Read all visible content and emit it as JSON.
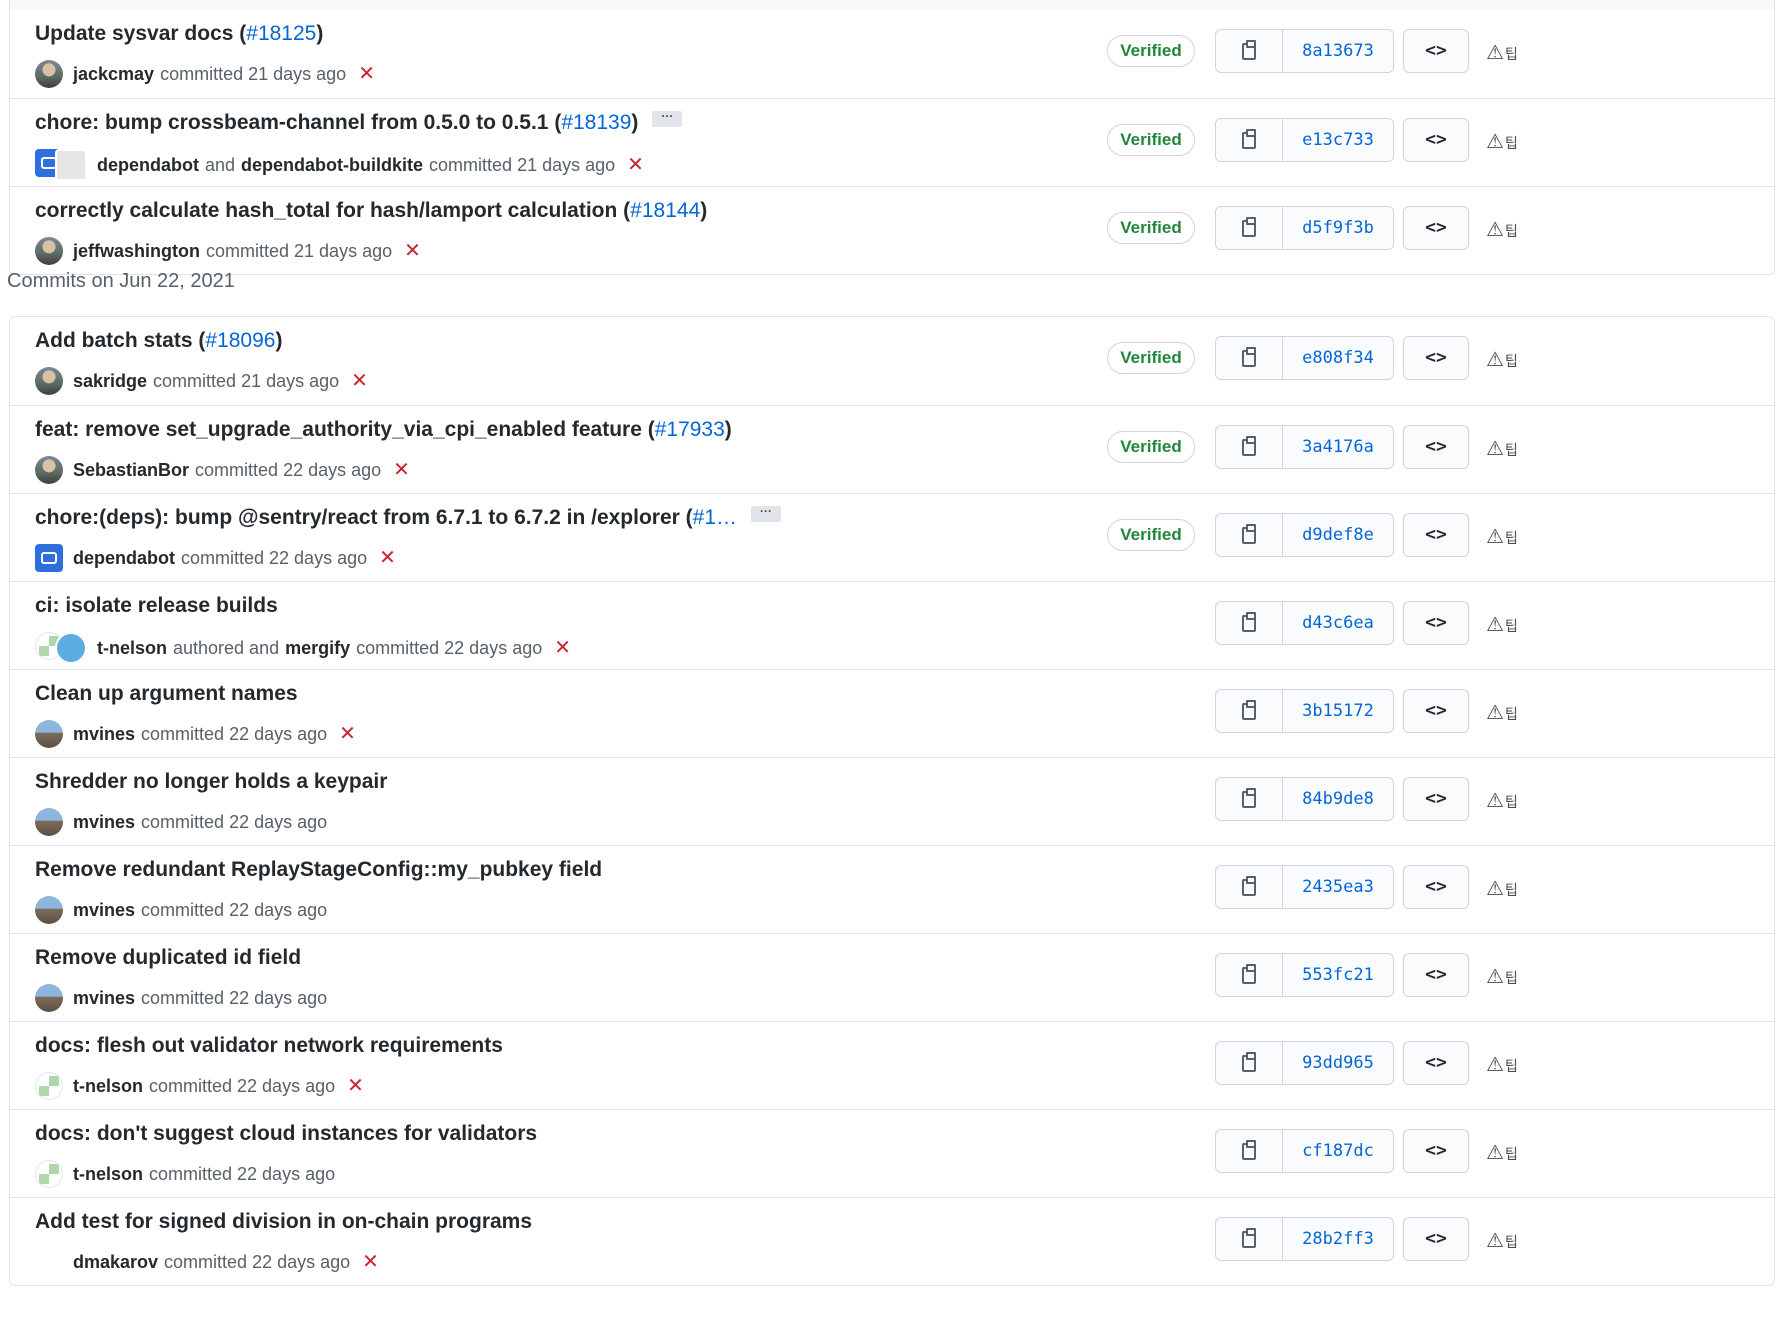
{
  "groups": [
    {
      "heading": "",
      "commits": [
        {
          "title_before": "Update sysvar docs (",
          "pr": "#18125",
          "title_after": ")",
          "has_more": false,
          "avatar": "photo",
          "users": [
            {
              "name": "jackcmay"
            }
          ],
          "meta_text": "committed 21 days ago",
          "status": "failure",
          "verified": "Verified",
          "sha": "8a13673"
        },
        {
          "title_before": "chore: bump crossbeam-channel from 0.5.0 to 0.5.1 (",
          "pr": "#18139",
          "title_after": ")",
          "has_more": true,
          "avatar": "bot-dual",
          "users": [
            {
              "name": "dependabot"
            },
            {
              "name": "dependabot-buildkite"
            }
          ],
          "joiner": "and",
          "meta_text": "committed 21 days ago",
          "status": "failure",
          "verified": "Verified",
          "sha": "e13c733"
        },
        {
          "title_before": "correctly calculate hash_total for hash/lamport calculation (",
          "pr": "#18144",
          "title_after": ")",
          "has_more": false,
          "avatar": "photo",
          "users": [
            {
              "name": "jeffwashington"
            }
          ],
          "meta_text": "committed 21 days ago",
          "status": "failure",
          "verified": "Verified",
          "sha": "d5f9f3b"
        }
      ]
    },
    {
      "heading": "Commits on Jun 22, 2021",
      "commits": [
        {
          "title_before": "Add batch stats (",
          "pr": "#18096",
          "title_after": ")",
          "has_more": false,
          "avatar": "photo",
          "users": [
            {
              "name": "sakridge"
            }
          ],
          "meta_text": "committed 21 days ago",
          "status": "failure",
          "verified": "Verified",
          "sha": "e808f34"
        },
        {
          "title_before": "feat: remove set_upgrade_authority_via_cpi_enabled feature (",
          "pr": "#17933",
          "title_after": ")",
          "has_more": false,
          "avatar": "photo",
          "users": [
            {
              "name": "SebastianBor"
            }
          ],
          "meta_text": "committed 22 days ago",
          "status": "failure",
          "verified": "Verified",
          "sha": "3a4176a"
        },
        {
          "title_before": "chore:(deps): bump @sentry/react from 6.7.1 to 6.7.2 in /explorer (",
          "pr": "#1…",
          "title_after": "",
          "has_more": true,
          "avatar": "bot",
          "users": [
            {
              "name": "dependabot"
            }
          ],
          "meta_text": "committed 22 days ago",
          "status": "failure",
          "verified": "Verified",
          "sha": "d9def8e"
        },
        {
          "title_before": "ci: isolate release builds",
          "pr": "",
          "title_after": "",
          "has_more": false,
          "avatar": "ident-dual",
          "users": [
            {
              "name": "t-nelson"
            },
            {
              "name": "mergify"
            }
          ],
          "joiner": "authored and",
          "meta_text": "committed 22 days ago",
          "status": "failure",
          "verified": "",
          "sha": "d43c6ea"
        },
        {
          "title_before": "Clean up argument names",
          "pr": "",
          "title_after": "",
          "has_more": false,
          "avatar": "land",
          "users": [
            {
              "name": "mvines"
            }
          ],
          "meta_text": "committed 22 days ago",
          "status": "failure",
          "verified": "",
          "sha": "3b15172"
        },
        {
          "title_before": "Shredder no longer holds a keypair",
          "pr": "",
          "title_after": "",
          "has_more": false,
          "avatar": "land",
          "users": [
            {
              "name": "mvines"
            }
          ],
          "meta_text": "committed 22 days ago",
          "status": "",
          "verified": "",
          "sha": "84b9de8"
        },
        {
          "title_before": "Remove redundant ReplayStageConfig::my_pubkey field",
          "pr": "",
          "title_after": "",
          "has_more": false,
          "avatar": "land",
          "users": [
            {
              "name": "mvines"
            }
          ],
          "meta_text": "committed 22 days ago",
          "status": "",
          "verified": "",
          "sha": "2435ea3"
        },
        {
          "title_before": "Remove duplicated id field",
          "pr": "",
          "title_after": "",
          "has_more": false,
          "avatar": "land",
          "users": [
            {
              "name": "mvines"
            }
          ],
          "meta_text": "committed 22 days ago",
          "status": "",
          "verified": "",
          "sha": "553fc21"
        },
        {
          "title_before": "docs: flesh out validator network requirements",
          "pr": "",
          "title_after": "",
          "has_more": false,
          "avatar": "ident",
          "users": [
            {
              "name": "t-nelson"
            }
          ],
          "meta_text": "committed 22 days ago",
          "status": "failure",
          "verified": "",
          "sha": "93dd965"
        },
        {
          "title_before": "docs: don't suggest cloud instances for validators",
          "pr": "",
          "title_after": "",
          "has_more": false,
          "avatar": "ident",
          "users": [
            {
              "name": "t-nelson"
            }
          ],
          "meta_text": "committed 22 days ago",
          "status": "",
          "verified": "",
          "sha": "cf187dc"
        },
        {
          "title_before": "Add test for signed division in on-chain programs",
          "pr": "",
          "title_after": "",
          "has_more": false,
          "avatar": "blank",
          "users": [
            {
              "name": "dmakarov"
            }
          ],
          "meta_text": "committed 22 days ago",
          "status": "failure",
          "verified": "",
          "sha": "28b2ff3"
        }
      ]
    }
  ],
  "icons": {
    "copy": "clipboard-icon",
    "browse": "code-icon",
    "status_failure": "x-icon",
    "extension": "warning-triangle-icon"
  },
  "glyphs": {
    "more": "···",
    "browse": "<>",
    "failure": "✕",
    "ext_tri": "⚠",
    "ext_mark": "팁"
  },
  "colors": {
    "link": "#0366d6",
    "verified": "#22863a",
    "failure": "#cb2431",
    "text": "#24292e",
    "muted": "#586069"
  }
}
